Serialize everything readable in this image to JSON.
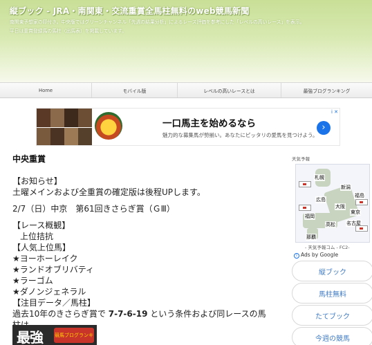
{
  "header": {
    "title": "縦ブック - JRA・南関東・交流重賞全馬柱無料のweb競馬新聞",
    "desc_lines": [
      "南関東予想家の印付き。中央版ではグリーンチャンネル「先週の結果分析」によるレース評価を参考にした「レベルの高いレース」を表示。",
      "平日は重賞登録馬の馬柱（出馬表）を掲載しています。"
    ]
  },
  "nav": [
    "Home",
    "モバイル版",
    "レベルの高いレースとは",
    "最強ブログランキング"
  ],
  "ad": {
    "headline": "一口馬主を始めるなら",
    "sub": "魅力的な募集馬が勢揃い。あなたにピッタリの愛馬を見つけよう。",
    "choices_label": "i ✕",
    "arrow_icon": "›",
    "colors": {
      "arrow": "#1a73e8"
    }
  },
  "main": {
    "section_title": "中央重賞",
    "notice_head": "【お知らせ】",
    "notice_body": "土曜メインおよび全重賞の確定版は後程UPします。",
    "race_line": "2/7（日）中京　第61回きさらぎ賞（ＧⅢ）",
    "overview_head": "【レース概観】",
    "overview_body": "上位拮抗",
    "popular_head": "【人気上位馬】",
    "popular": [
      "★ヨーホーレイク",
      "★ランドオブリバティ",
      "★ラーゴム",
      "★ダノンジェネラル"
    ],
    "note_head": "【注目データ／馬柱】",
    "note_pre": "過去10年のきさらぎ賞で ",
    "note_bold": "7-7-6-19",
    "note_post": " という条件および同レースの馬",
    "note_line2": "柱は…",
    "logo_text": "最強",
    "logo_rank": "競馬ブログランキング"
  },
  "sidebar": {
    "map_title": "天気予報",
    "map_labels": [
      "札幌",
      "新潟",
      "福島",
      "広島",
      "大阪",
      "東京",
      "福岡",
      "高松",
      "名古屋",
      "那覇"
    ],
    "map_caption": "- 天気予報コム - FC2-",
    "ads_by": "Ads by Google",
    "ads_by_icon": "i",
    "links": [
      "縦ブック",
      "馬柱無料",
      "たてブック",
      "今週の競馬"
    ]
  }
}
